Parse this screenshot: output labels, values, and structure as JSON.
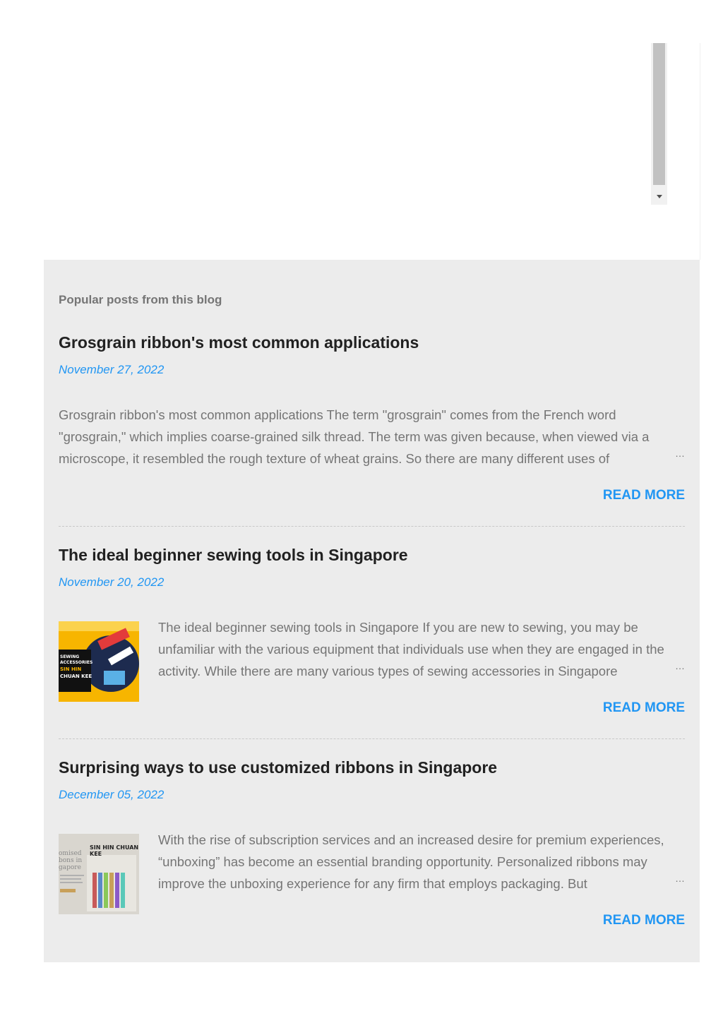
{
  "popular": {
    "heading": "Popular posts from this blog",
    "posts": [
      {
        "title": "Grosgrain ribbon's most common applications",
        "date": "November 27, 2022",
        "snippet": "Grosgrain ribbon's most common applications The term \"grosgrain\" comes from the French word \"grosgrain,\" which implies coarse-grained silk thread. The term was given because, when viewed via a microscope, it resembled the rough texture of wheat grains. So there are many different uses of",
        "ellipsis": "…",
        "read_more": "READ MORE",
        "has_thumbnail": false
      },
      {
        "title": "The ideal beginner sewing tools in Singapore",
        "date": "November 20, 2022",
        "snippet": "  The ideal beginner sewing tools in Singapore If you are new to sewing, you may be unfamiliar with the various equipment that individuals use when they are engaged in the activity. While there are many various types of sewing accessories in Singapore",
        "ellipsis": "…",
        "read_more": "READ MORE",
        "has_thumbnail": true,
        "thumbnail": {
          "lines": [
            "SEWING",
            "ACCESSORIES",
            "SIN HIN",
            "CHUAN KEE"
          ],
          "colors": [
            "#f7b500",
            "#1d2b4f",
            "#e33b3b"
          ]
        }
      },
      {
        "title": "Surprising ways to use customized ribbons in Singapore",
        "date": "December 05, 2022",
        "snippet": "With the rise of subscription services and an increased desire for premium experiences, “unboxing” has become an essential branding opportunity. Personalized ribbons may improve the unboxing experience for any firm that employs packaging. But",
        "ellipsis": "…",
        "read_more": "READ MORE",
        "has_thumbnail": true,
        "thumbnail": {
          "lines": [
            "SIN HIN CHUAN",
            "KEE",
            "omised",
            "bons in",
            "gapore"
          ],
          "colors": [
            "#d9d6cf",
            "#8a8a8a",
            "#c85a5a"
          ]
        }
      }
    ]
  }
}
